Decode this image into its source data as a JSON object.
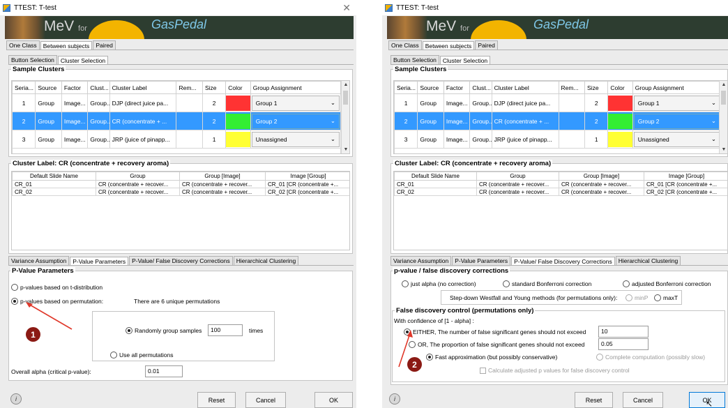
{
  "left": {
    "window_title": "TTEST: T-test",
    "banner": {
      "mev": "MeV",
      "for": "for",
      "brand": "GasPedal"
    },
    "top_tabs": [
      "One Class",
      "Between subjects",
      "Paired"
    ],
    "sub_tabs": [
      "Button Selection",
      "Cluster Selection"
    ],
    "sample_clusters": {
      "title": "Sample Clusters",
      "columns": [
        "Seria...",
        "Source",
        "Factor",
        "Clust...",
        "Cluster Label",
        "Rem...",
        "Size",
        "Color",
        "Group Assignment"
      ],
      "rows": [
        {
          "serial": "1",
          "source": "Group",
          "factor": "Image...",
          "clust": "Group...",
          "label": "DJP (direct juice pa...",
          "rem": "",
          "size": "2",
          "color": "#ff3333",
          "group": "Group 1"
        },
        {
          "serial": "2",
          "source": "Group",
          "factor": "Image...",
          "clust": "Group...",
          "label": "CR (concentrate + ...",
          "rem": "",
          "size": "2",
          "color": "#33ee33",
          "group": "Group 2"
        },
        {
          "serial": "3",
          "source": "Group",
          "factor": "Image...",
          "clust": "Group...",
          "label": "JRP (juice of pinapp...",
          "rem": "",
          "size": "1",
          "color": "#ffff33",
          "group": "Unassigned"
        }
      ]
    },
    "cluster_label": {
      "title": "Cluster Label: CR (concentrate + recovery aroma)",
      "columns": [
        "Default Slide Name",
        "Group",
        "Group [Image]",
        "Image [Group]"
      ],
      "rows": [
        [
          "CR_01",
          "CR (concentrate + recover...",
          "CR (concentrate + recover...",
          "CR_01 [CR (concentrate +..."
        ],
        [
          "CR_02",
          "CR (concentrate + recover...",
          "CR (concentrate + recover...",
          "CR_02 [CR (concentrate +..."
        ]
      ]
    },
    "bottom_tabs": [
      "Variance Assumption",
      "P-Value Parameters",
      "P-Value/ False Discovery Corrections",
      "Hierarchical Clustering"
    ],
    "pvalue": {
      "title": "P-Value Parameters",
      "opt_t": "p-values based on t-distribution",
      "opt_perm": "p-values based on permutation:",
      "perm_note": "There are 6 unique permutations",
      "random_label": "Randomly group samples",
      "random_value": "100",
      "times": "times",
      "all_perm": "Use all permutations",
      "alpha_label": "Overall alpha (critical p-value):",
      "alpha_value": "0.01"
    },
    "badge": "1",
    "buttons": {
      "reset": "Reset",
      "cancel": "Cancel",
      "ok": "OK"
    }
  },
  "right": {
    "window_title": "TTEST: T-test",
    "banner": {
      "mev": "MeV",
      "for": "for",
      "brand": "GasPedal"
    },
    "top_tabs": [
      "One Class",
      "Between subjects",
      "Paired"
    ],
    "sub_tabs": [
      "Button Selection",
      "Cluster Selection"
    ],
    "sample_clusters": {
      "title": "Sample Clusters",
      "columns": [
        "Seria...",
        "Source",
        "Factor",
        "Clust...",
        "Cluster Label",
        "Rem...",
        "Size",
        "Color",
        "Group Assignment"
      ],
      "rows": [
        {
          "serial": "1",
          "source": "Group",
          "factor": "Image...",
          "clust": "Group...",
          "label": "DJP (direct juice pa...",
          "rem": "",
          "size": "2",
          "color": "#ff3333",
          "group": "Group 1"
        },
        {
          "serial": "2",
          "source": "Group",
          "factor": "Image...",
          "clust": "Group...",
          "label": "CR (concentrate + ...",
          "rem": "",
          "size": "2",
          "color": "#33ee33",
          "group": "Group 2"
        },
        {
          "serial": "3",
          "source": "Group",
          "factor": "Image...",
          "clust": "Group...",
          "label": "JRP (juice of pinapp...",
          "rem": "",
          "size": "1",
          "color": "#ffff33",
          "group": "Unassigned"
        }
      ]
    },
    "cluster_label": {
      "title": "Cluster Label: CR (concentrate + recovery aroma)",
      "columns": [
        "Default Slide Name",
        "Group",
        "Group [Image]",
        "Image [Group]"
      ],
      "rows": [
        [
          "CR_01",
          "CR (concentrate + recover...",
          "CR (concentrate + recover...",
          "CR_01 [CR (concentrate +..."
        ],
        [
          "CR_02",
          "CR (concentrate + recover...",
          "CR (concentrate + recover...",
          "CR_02 [CR (concentrate +..."
        ]
      ]
    },
    "bottom_tabs": [
      "Variance Assumption",
      "P-Value Parameters",
      "P-Value/ False Discovery Corrections",
      "Hierarchical Clustering"
    ],
    "corrections": {
      "title": "p-value / false discovery corrections",
      "just_alpha": "just alpha (no correction)",
      "bonferroni": "standard Bonferroni correction",
      "adj_bonferroni": "adjusted Bonferroni correction",
      "stepdown": "Step-down Westfall and Young methods (for permutations only):",
      "minp": "minP",
      "maxt": "maxT",
      "fdc_title": "False discovery control (permutations only)",
      "confidence": "With confidence of [1 - alpha] :",
      "either": "EITHER, The number of false significant genes should not exceed",
      "either_value": "10",
      "or": "OR, The proportion of false significant genes should not exceed",
      "or_value": "0.05",
      "fast": "Fast approximation (but possibly conservative)",
      "complete": "Complete computation (possibly slow)",
      "calc_adj": "Calculate adjusted p values for false discovery control"
    },
    "badge": "2",
    "buttons": {
      "reset": "Reset",
      "cancel": "Cancel",
      "ok": "OK"
    }
  }
}
